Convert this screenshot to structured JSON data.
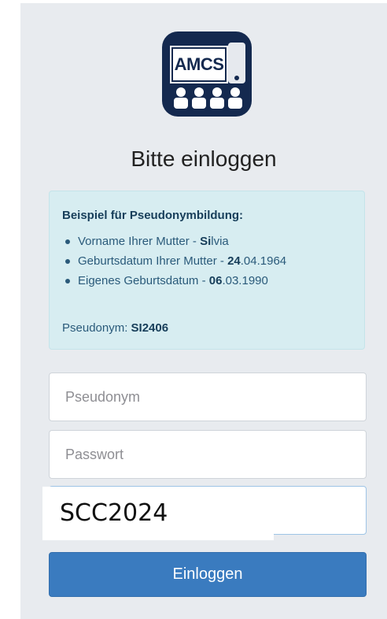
{
  "logo": {
    "text": "AMCS",
    "icon": "amcs-logo"
  },
  "heading": "Bitte einloggen",
  "info": {
    "title": "Beispiel für Pseudonymbildung:",
    "items": [
      {
        "prefix": "Vorname Ihrer Mutter - ",
        "bold": "Si",
        "suffix": "lvia"
      },
      {
        "prefix": "Geburtsdatum Ihrer Mutter - ",
        "bold": "24",
        "suffix": ".04.1964"
      },
      {
        "prefix": "Eigenes Geburtsdatum - ",
        "bold": "06",
        "suffix": ".03.1990"
      }
    ],
    "pseudonym_label": "Pseudonym: ",
    "pseudonym_value": "SI2406"
  },
  "form": {
    "pseudonym_placeholder": "Pseudonym",
    "password_placeholder": "Passwort",
    "third_value": "",
    "overlay_text": "SCC2024",
    "submit_label": "Einloggen"
  },
  "colors": {
    "primary": "#3a7bbf",
    "info_bg": "#d7edf1",
    "logo_bg": "#14294f"
  }
}
